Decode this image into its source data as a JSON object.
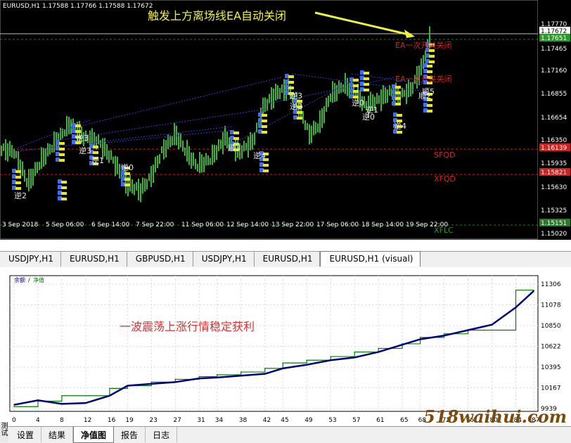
{
  "main_chart": {
    "symbol_info": "EURUSD,H1  1.17588 1.17766 1.17588 1.17672",
    "annotation_top": "触发上方离场线EA自动关闭",
    "price_labels": [
      "1.17770",
      "1.17672",
      "1.17651",
      "1.17465",
      "1.17160",
      "1.16855",
      "1.16654",
      "1.16350",
      "1.16139",
      "1.15935",
      "1.15821",
      "1.15630",
      "1.15325",
      "1.15151",
      "1.15020"
    ],
    "line_labels": {
      "ea1": "EA一次开关关闭",
      "ea2": "EA一次开关关闭",
      "sfqd": "SFQD",
      "xfqd": "XFQD",
      "xflc": "XFLC"
    },
    "time_labels": [
      "3 Sep 2018",
      "5 Sep 06:00",
      "6 Sep 14:00",
      "7 Sep 22:00",
      "11 Sep 06:00",
      "12 Sep 14:00",
      "13 Sep 22:00",
      "17 Sep 06:00",
      "18 Sep 14:00",
      "19 Sep 22:00"
    ],
    "trade_labels": [
      "逆2",
      "逆3",
      "逆1",
      "逆0",
      "逆3",
      "顺3",
      "逆4",
      "逆3",
      "逆2",
      "逆0",
      "逆0",
      "逆1",
      "逆4",
      "顺5",
      "顺2"
    ]
  },
  "symbol_tabs": [
    {
      "label": "USDJPY,H1",
      "active": false
    },
    {
      "label": "EURUSD,H1",
      "active": false
    },
    {
      "label": "GBPUSD,H1",
      "active": false
    },
    {
      "label": "USDJPY,H1",
      "active": false
    },
    {
      "label": "EURUSD,H1",
      "active": false
    },
    {
      "label": "EURUSD,H1 (visual)",
      "active": true
    }
  ],
  "equity_panel": {
    "legend_balance": "余额",
    "legend_sep": "/",
    "legend_equity": "净值",
    "annotation": "一波震荡上涨行情稳定获利",
    "colors": {
      "balance": "#008000",
      "equity": "#000080",
      "annotation": "#e03030"
    }
  },
  "bottom_tabs": [
    "设置",
    "结果",
    "净值图",
    "报告",
    "日志"
  ],
  "side_label": "测试",
  "watermark": "518waihui.com",
  "chart_data": {
    "type": "line",
    "x": [
      0,
      4,
      8,
      12,
      16,
      19,
      23,
      27,
      31,
      34,
      38,
      42,
      45,
      49,
      53,
      57,
      61,
      65,
      68,
      72,
      76,
      80,
      84,
      87
    ],
    "x_tick_labels": [
      "0",
      "4",
      "8",
      "12",
      "16",
      "19",
      "23",
      "27",
      "31",
      "34",
      "38",
      "42",
      "45",
      "49",
      "53",
      "57",
      "61",
      "65",
      "68",
      "72",
      "76",
      "80",
      "84",
      "87"
    ],
    "y_tick_labels": [
      "11306",
      "11078",
      "10850",
      "10622",
      "10395",
      "10167",
      "9939"
    ],
    "ylim": [
      9939,
      11306
    ],
    "series": [
      {
        "name": "余额",
        "values": [
          9960,
          10020,
          10080,
          10080,
          10160,
          10190,
          10230,
          10260,
          10290,
          10310,
          10340,
          10380,
          10440,
          10470,
          10510,
          10560,
          10600,
          10650,
          10720,
          10760,
          10800,
          10800,
          11240,
          11240
        ]
      },
      {
        "name": "净值",
        "values": [
          9980,
          10030,
          9990,
          10000,
          10080,
          10190,
          10210,
          10230,
          10270,
          10280,
          10300,
          10320,
          10380,
          10420,
          10470,
          10500,
          10560,
          10640,
          10700,
          10740,
          10800,
          10860,
          11050,
          11230
        ]
      }
    ]
  }
}
